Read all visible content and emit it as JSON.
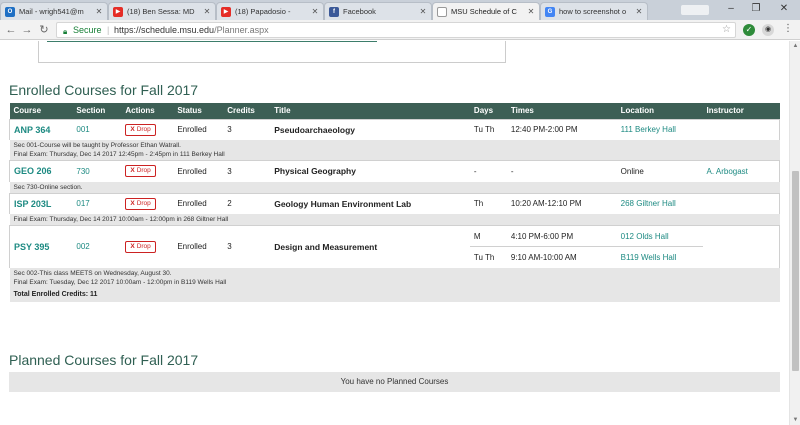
{
  "browser": {
    "tabs": [
      {
        "label": "Mail - wrigh541@m",
        "icon": "outlook-icon",
        "color": "#1e6fc4",
        "active": false
      },
      {
        "label": "(18) Ben Sessa: MD",
        "icon": "youtube-icon",
        "color": "#e52d27",
        "active": false
      },
      {
        "label": "(18) Papadosio -",
        "icon": "youtube-icon",
        "color": "#e52d27",
        "active": false
      },
      {
        "label": "Facebook",
        "icon": "facebook-icon",
        "color": "#3b5998",
        "active": false
      },
      {
        "label": "MSU Schedule of C",
        "icon": "page-icon",
        "color": "#ffffff",
        "active": true
      },
      {
        "label": "how to screenshot o",
        "icon": "google-icon",
        "color": "#4285f4",
        "active": false
      }
    ],
    "secure_label": "Secure",
    "url_host": "https://schedule.msu.edu",
    "url_path": "/Planner.aspx"
  },
  "enrolled": {
    "title": "Enrolled Courses for Fall 2017",
    "headers": {
      "course": "Course",
      "section": "Section",
      "actions": "Actions",
      "status": "Status",
      "credits": "Credits",
      "title": "Title",
      "days": "Days",
      "times": "Times",
      "location": "Location",
      "instructor": "Instructor"
    },
    "drop_label": "Drop",
    "courses": [
      {
        "course": "ANP 364",
        "section": "001",
        "status": "Enrolled",
        "credits": "3",
        "title": "Pseudoarchaeology",
        "meetings": [
          {
            "days": "Tu Th",
            "times": "12:40 PM-2:00 PM",
            "location": "111 Berkey Hall"
          }
        ],
        "instructor": "",
        "notes": [
          "Sec 001-Course will be taught by Professor Ethan Watrall.",
          "Final Exam: Thursday, Dec 14 2017 12:45pm - 2:45pm in 111 Berkey Hall"
        ]
      },
      {
        "course": "GEO 206",
        "section": "730",
        "status": "Enrolled",
        "credits": "3",
        "title": "Physical Geography",
        "meetings": [
          {
            "days": "-",
            "times": "-",
            "location": "Online"
          }
        ],
        "instructor": "A. Arbogast",
        "notes": [
          "Sec 730-Online section."
        ]
      },
      {
        "course": "ISP 203L",
        "section": "017",
        "status": "Enrolled",
        "credits": "2",
        "title": "Geology Human Environment Lab",
        "meetings": [
          {
            "days": "Th",
            "times": "10:20 AM-12:10 PM",
            "location": "268 Giltner Hall"
          }
        ],
        "instructor": "",
        "notes": [
          "Final Exam: Thursday, Dec 14 2017 10:00am - 12:00pm in 268 Giltner Hall"
        ]
      },
      {
        "course": "PSY 395",
        "section": "002",
        "status": "Enrolled",
        "credits": "3",
        "title": "Design and Measurement",
        "meetings": [
          {
            "days": "M",
            "times": "4:10 PM-6:00 PM",
            "location": "012 Olds Hall"
          },
          {
            "days": "Tu Th",
            "times": "9:10 AM-10:00 AM",
            "location": "B119 Wells Hall"
          }
        ],
        "instructor": "",
        "notes": [
          "Sec 002-This class MEETS on Wednesday, August 30.",
          "Final Exam: Tuesday, Dec 12 2017 10:00am - 12:00pm in B119 Wells Hall"
        ]
      }
    ],
    "total_label": "Total Enrolled Credits: 11"
  },
  "planned": {
    "title": "Planned Courses for Fall 2017",
    "empty_message": "You have no Planned Courses"
  },
  "colors": {
    "header_bg": "#3d5f55",
    "link": "#1d8a82",
    "drop_red": "#cc2222"
  }
}
